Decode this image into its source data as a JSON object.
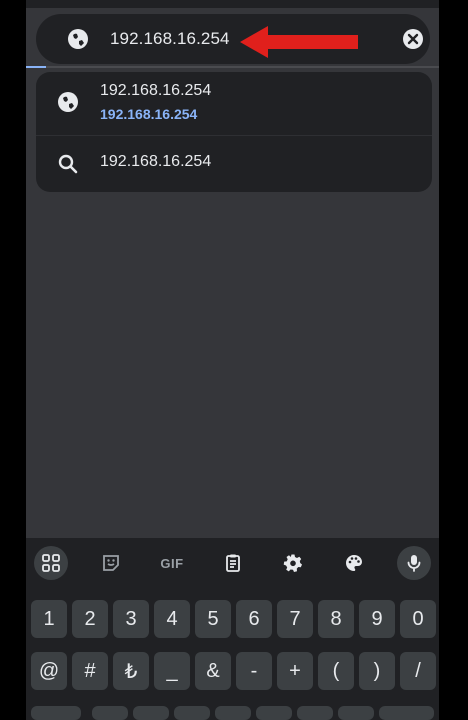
{
  "urlbar": {
    "url": "192.168.16.254"
  },
  "suggestions": [
    {
      "title": "192.168.16.254",
      "subtitle": "192.168.16.254",
      "icon": "globe-icon"
    },
    {
      "title": "192.168.16.254",
      "icon": "search-icon"
    }
  ],
  "keyboard": {
    "toolbar": {
      "gif_label": "GIF"
    },
    "number_row": [
      "1",
      "2",
      "3",
      "4",
      "5",
      "6",
      "7",
      "8",
      "9",
      "0"
    ],
    "symbol_row": [
      "@",
      "#",
      "₺",
      "_",
      "&",
      "-",
      "+",
      "(",
      ")",
      "/"
    ]
  },
  "colors": {
    "accent": "#8ab4f8",
    "background": "#35363a",
    "surface": "#202124",
    "annotation_arrow": "#e0201c"
  }
}
